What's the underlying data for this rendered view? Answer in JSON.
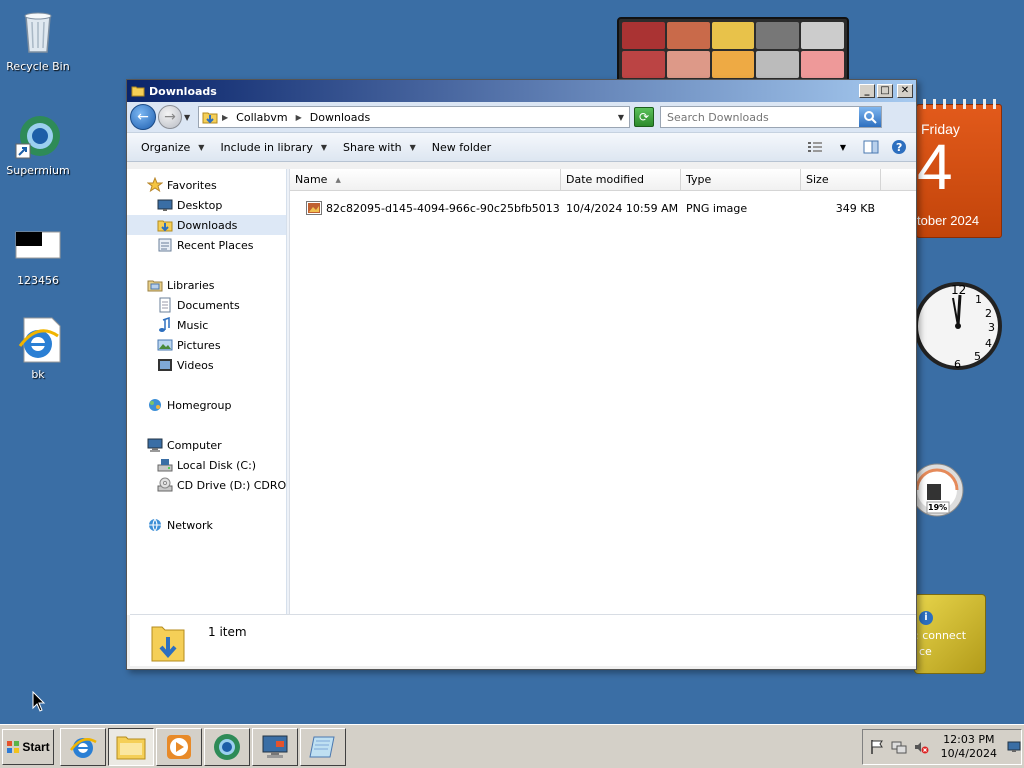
{
  "desktop": {
    "icons": [
      {
        "label": "Recycle Bin"
      },
      {
        "label": "Supermium"
      },
      {
        "label": "123456"
      },
      {
        "label": "bk"
      }
    ]
  },
  "gadgets": {
    "calendar": {
      "weekday": "Friday",
      "day": "4",
      "month_year": "tober 2024"
    },
    "cpu_meter": {
      "value": "19%"
    },
    "feed": {
      "text_line1": ": connect",
      "text_line2": "ce"
    }
  },
  "window": {
    "title": "Downloads",
    "address": {
      "crumbs": [
        "Collabvm",
        "Downloads"
      ]
    },
    "search": {
      "placeholder": "Search Downloads"
    },
    "toolbar": {
      "organize": "Organize",
      "include": "Include in library",
      "share": "Share with",
      "new_folder": "New folder"
    },
    "nav": {
      "favorites": {
        "label": "Favorites",
        "items": [
          "Desktop",
          "Downloads",
          "Recent Places"
        ]
      },
      "libraries": {
        "label": "Libraries",
        "items": [
          "Documents",
          "Music",
          "Pictures",
          "Videos"
        ]
      },
      "homegroup": {
        "label": "Homegroup"
      },
      "computer": {
        "label": "Computer",
        "items": [
          "Local Disk (C:)",
          "CD Drive (D:) CDROM"
        ]
      },
      "network": {
        "label": "Network"
      }
    },
    "columns": {
      "name": "Name",
      "date": "Date modified",
      "type": "Type",
      "size": "Size"
    },
    "files": [
      {
        "name": "82c82095-d145-4094-966c-90c25bfb5013",
        "date": "10/4/2024 10:59 AM",
        "type": "PNG image",
        "size": "349 KB"
      }
    ],
    "details": {
      "count": "1 item"
    }
  },
  "taskbar": {
    "start": "Start",
    "clock": {
      "time": "12:03 PM",
      "date": "10/4/2024"
    }
  },
  "colors": {
    "desktop": "#3a6ea5",
    "titlebar_start": "#0a246a",
    "titlebar_end": "#a6caf0",
    "selection": "#dde8f6"
  }
}
